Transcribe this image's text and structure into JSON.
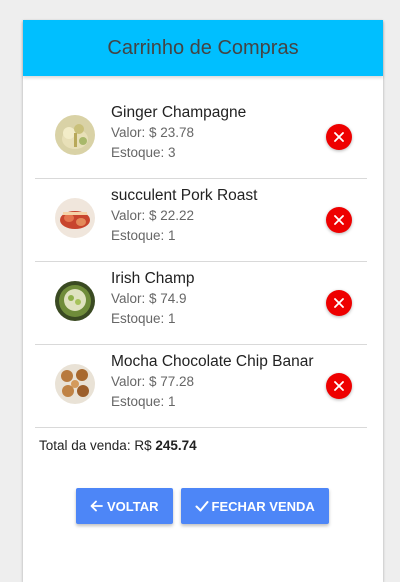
{
  "header": {
    "title": "Carrinho de Compras"
  },
  "cart": {
    "items": [
      {
        "name": "Ginger Champagne",
        "price": "Valor: $ 23.78",
        "stock": "Estoque: 3"
      },
      {
        "name": "succulent Pork Roast",
        "price": "Valor: $ 22.22",
        "stock": "Estoque: 1"
      },
      {
        "name": "Irish Champ",
        "price": "Valor: $ 74.9",
        "stock": "Estoque: 1"
      },
      {
        "name": "Mocha Chocolate Chip Banar",
        "price": "Valor: $ 77.28",
        "stock": "Estoque: 1"
      }
    ],
    "total_label": "Total da venda: R$",
    "total_value": "245.74"
  },
  "actions": {
    "back_label": "VOLTAR",
    "close_sale_label": "FECHAR VENDA"
  },
  "colors": {
    "header": "#00bfff",
    "button": "#4d86f7",
    "remove": "#ee0000"
  },
  "icons": {
    "remove": "close-icon",
    "back": "arrow-left-icon",
    "confirm": "check-icon"
  }
}
